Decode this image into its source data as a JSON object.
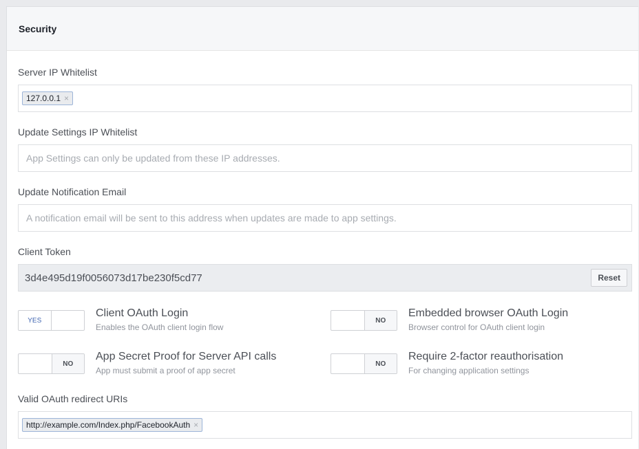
{
  "header": {
    "title": "Security"
  },
  "server_ip_whitelist": {
    "label": "Server IP Whitelist",
    "tokens": [
      "127.0.0.1"
    ],
    "remove_glyph": "×"
  },
  "update_settings_ip_whitelist": {
    "label": "Update Settings IP Whitelist",
    "placeholder": "App Settings can only be updated from these IP addresses."
  },
  "update_notification_email": {
    "label": "Update Notification Email",
    "placeholder": "A notification email will be sent to this address when updates are made to app settings."
  },
  "client_token": {
    "label": "Client Token",
    "value": "3d4e495d19f0056073d17be230f5cd77",
    "reset_label": "Reset"
  },
  "toggles": [
    {
      "title": "Client OAuth Login",
      "description": "Enables the OAuth client login flow",
      "state": "YES",
      "enabled": true
    },
    {
      "title": "Embedded browser OAuth Login",
      "description": "Browser control for OAuth client login",
      "state": "NO",
      "enabled": false
    },
    {
      "title": "App Secret Proof for Server API calls",
      "description": "App must submit a proof of app secret",
      "state": "NO",
      "enabled": false
    },
    {
      "title": "Require 2-factor reauthorisation",
      "description": "For changing application settings",
      "state": "NO",
      "enabled": false
    }
  ],
  "valid_oauth_redirect_uris": {
    "label": "Valid OAuth redirect URIs",
    "tokens": [
      "http://example.com/Index.php/FacebookAuth"
    ],
    "remove_glyph": "×"
  },
  "colors": {
    "accent": "#4267b2",
    "panel_header_bg": "#f6f7f9",
    "readonly_bg": "#ebedf0",
    "token_border": "#9cb4d8"
  }
}
